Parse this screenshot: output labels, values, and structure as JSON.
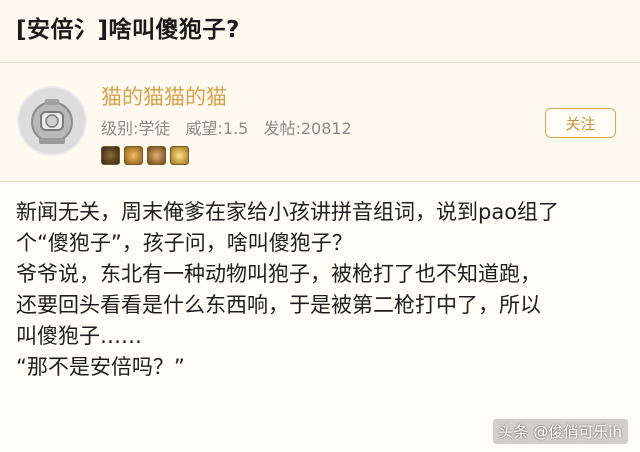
{
  "thread": {
    "title": "[安倍氵]啥叫傻狍子?"
  },
  "user": {
    "name": "猫的猫猫的猫",
    "level": "级别:学徒",
    "prestige": "威望:1.5",
    "posts": "发帖:20812",
    "follow_label": "关注",
    "badges": [
      {
        "icon": "medal-badge-icon",
        "color": "#5a3d1f"
      },
      {
        "icon": "medal-badge-icon",
        "color": "#b07a2a"
      },
      {
        "icon": "medal-badge-icon",
        "color": "#9a6a2c"
      },
      {
        "icon": "medal-badge-icon",
        "color": "#c7952f"
      }
    ]
  },
  "post": {
    "lines": [
      "新闻无关，周末俺爹在家给小孩讲拼音组词，说到pao组了",
      "个“傻狍子”，孩子问，啥叫傻狍子？",
      "爷爷说，东北有一种动物叫狍子，被枪打了也不知道跑，",
      "还要回头看看是什么东西响，于是被第二枪打中了，所以",
      "叫傻狍子……",
      "“那不是安倍吗？”"
    ]
  },
  "watermark": "头条 @俊俏可乐ih"
}
